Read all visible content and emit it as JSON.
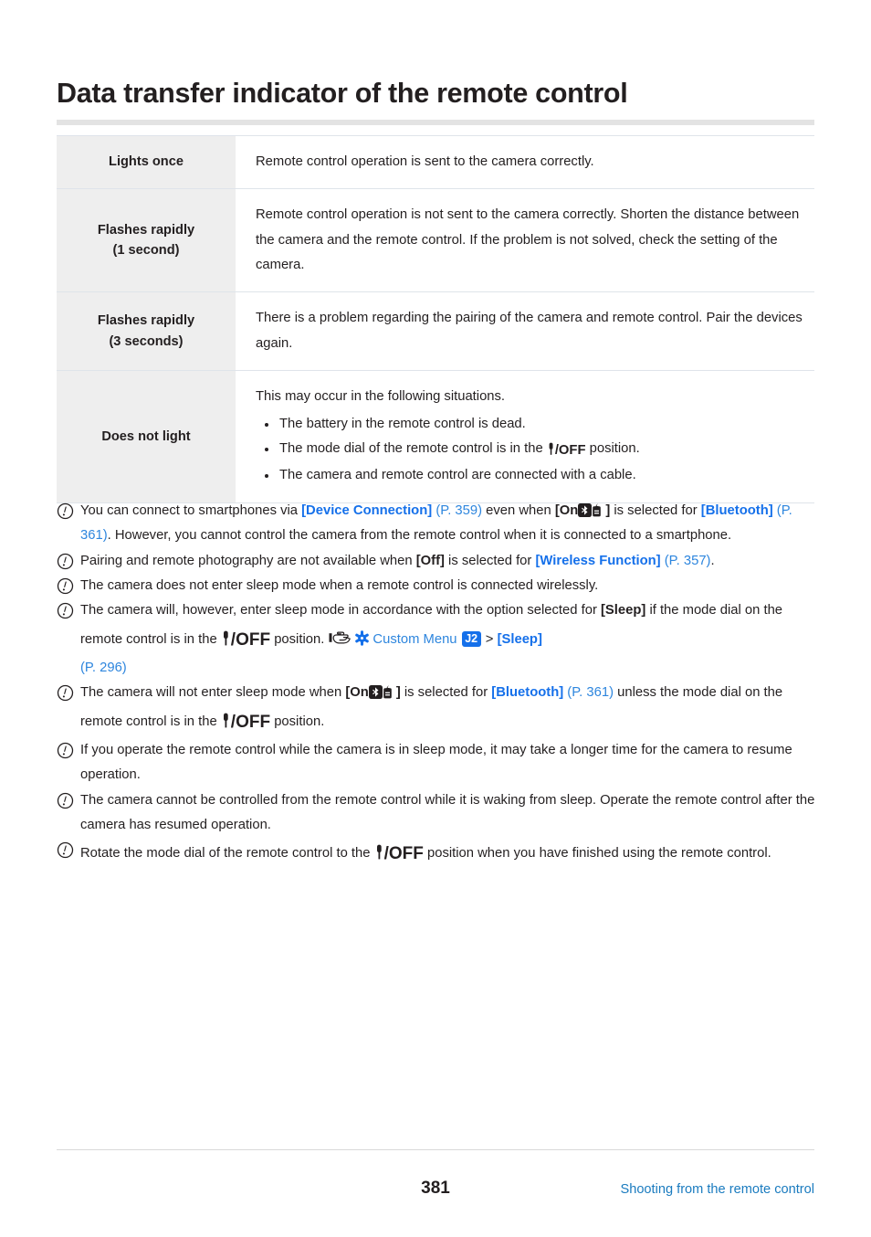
{
  "page": {
    "title": "Data transfer indicator of the remote control",
    "page_number": "381",
    "footer_link": "Shooting from the remote control",
    "accent_link_color": "#1570ea",
    "accent_pref_color": "#2e86de",
    "footer_link_color": "#1a7bbf",
    "label_cell_bg": "#eeeeee",
    "rule_color": "#e3e3e3"
  },
  "table": {
    "rows": [
      {
        "label": "Lights once",
        "desc_lead": "Remote control operation is sent to the camera correctly.",
        "items": []
      },
      {
        "label": "Flashes rapidly\n(1 second)",
        "desc_lead": "Remote control operation is not sent to the camera correctly. Shorten the distance between the camera and the remote control. If the problem is not solved, check the setting of the camera.",
        "items": []
      },
      {
        "label": "Flashes rapidly\n(3 seconds)",
        "desc_lead": "There is a problem regarding the pairing of the camera and remote control. Pair the devices again.",
        "items": []
      },
      {
        "label": "Does not light",
        "desc_lead": "This may occur in the following situations.",
        "items": [
          "The battery in the remote control is dead.",
          "The mode dial of the remote control is in the  /OFF  position.",
          "The camera and remote control are connected with a cable."
        ]
      }
    ],
    "row_labels": {
      "r0": "Lights once",
      "r1_line1": "Flashes rapidly",
      "r1_line2": "(1 second)",
      "r2_line1": "Flashes rapidly",
      "r2_line2": "(3 seconds)",
      "r3": "Does not light"
    },
    "row3_bullets": {
      "b0": "The battery in the remote control is dead.",
      "b1_pre": "The mode dial of the remote control is in the ",
      "b1_post": " position.",
      "b2": "The camera and remote control are connected with a cable."
    },
    "row0_desc": "Remote control operation is sent to the camera correctly.",
    "row1_desc": "Remote control operation is not sent to the camera correctly. Shorten the distance between the camera and the remote control. If the problem is not solved, check the setting of the camera.",
    "row2_desc": "There is a problem regarding the pairing of the camera and remote control. Pair the devices again.",
    "row3_lead": "This may occur in the following situations."
  },
  "notes": {
    "n1": {
      "t1": "You can connect to smartphones via ",
      "link1": "[Device Connection]",
      "ref1": "(P. 359)",
      "t2": " even when ",
      "on_label": "[On",
      "on_close": "]",
      "t3": " is selected for ",
      "link2": "[Bluetooth]",
      "ref2": "(P. 361)",
      "t4": ". However, you cannot control the camera from the remote control when it is connected to a smartphone."
    },
    "n2": {
      "t1": "Pairing and remote photography are not available when ",
      "bold1": "[Off]",
      "t2": " is selected for ",
      "link1": "[Wireless Function]",
      "ref1": "(P. 357)",
      "t3": "."
    },
    "n3": {
      "t1": "The camera does not enter sleep mode when a remote control is connected wirelessly."
    },
    "n4": {
      "t1": "The camera will, however, enter sleep mode in accordance with the option selected for ",
      "bold1": "[Sleep]",
      "t2": " if the mode dial on the remote control is in the ",
      "t3": " position. ",
      "menu": "Custom Menu",
      "badge": "J2",
      "sep": ">",
      "link1": "[Sleep]",
      "ref1": "(P. 296)"
    },
    "n5": {
      "t1": "The camera will not enter sleep mode when ",
      "on_label": "[On",
      "on_close": "]",
      "t2": " is selected for ",
      "link1": "[Bluetooth]",
      "ref1": "(P. 361)",
      "t3": " unless the mode dial on the remote control is in the ",
      "t4": " position."
    },
    "n6": {
      "t1": "If you operate the remote control while the camera is in sleep mode, it may take a longer time for the camera to resume operation."
    },
    "n7": {
      "t1": "The camera cannot be controlled from the remote control while it is waking from sleep. Operate the remote control after the camera has resumed operation."
    },
    "n8": {
      "t1": "Rotate the mode dial of the remote control to the ",
      "t2": " position when you have finished using the remote control."
    }
  },
  "icons": {
    "note_marker": "exclamation-circle-icon",
    "bluetooth": "bluetooth-icon",
    "mic_off": "mic-off-icon",
    "hand_pointer": "hand-pointer-icon",
    "gear": "gear-icon"
  },
  "glyph_text": {
    "off": "/OFF"
  }
}
